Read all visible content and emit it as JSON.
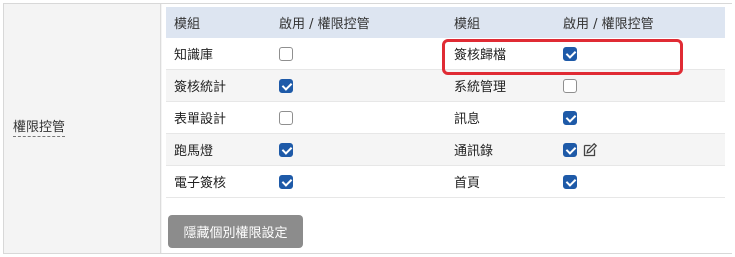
{
  "section_label": "權限控管",
  "headers": {
    "module": "模組",
    "enable": "啟用 / 權限控管"
  },
  "rows": [
    {
      "left": {
        "name": "知識庫",
        "checked": false
      },
      "right": {
        "name": "簽核歸檔",
        "checked": true,
        "highlighted": true
      }
    },
    {
      "left": {
        "name": "簽核統計",
        "checked": true
      },
      "right": {
        "name": "系統管理",
        "checked": false
      }
    },
    {
      "left": {
        "name": "表單設計",
        "checked": false
      },
      "right": {
        "name": "訊息",
        "checked": true
      }
    },
    {
      "left": {
        "name": "跑馬燈",
        "checked": true
      },
      "right": {
        "name": "通訊錄",
        "checked": true,
        "edit_icon": "edit-icon"
      }
    },
    {
      "left": {
        "name": "電子簽核",
        "checked": true
      },
      "right": {
        "name": "首頁",
        "checked": true
      }
    }
  ],
  "hide_button_label": "隱藏個別權限設定",
  "colors": {
    "header_bg": "#dde5f1",
    "checkbox_on": "#1e5aa8",
    "highlight": "#e02b34",
    "button_bg": "#8c8c8c"
  }
}
